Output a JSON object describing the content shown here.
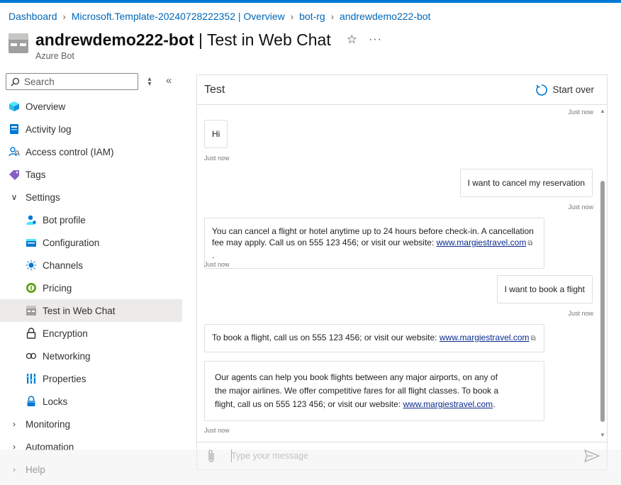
{
  "breadcrumb": {
    "items": [
      "Dashboard",
      "Microsoft.Template-20240728222352 | Overview",
      "bot-rg",
      "andrewdemo222-bot"
    ]
  },
  "header": {
    "resource_name": "andrewdemo222-bot",
    "page_name": "| Test in Web Chat",
    "subtitle": "Azure Bot",
    "favorite_icon": "star-icon",
    "more_icon": "ellipsis-icon"
  },
  "search": {
    "placeholder": "Search"
  },
  "nav": {
    "overview": "Overview",
    "activity_log": "Activity log",
    "access_control": "Access control (IAM)",
    "tags": "Tags",
    "settings": "Settings",
    "bot_profile": "Bot profile",
    "configuration": "Configuration",
    "channels": "Channels",
    "pricing": "Pricing",
    "test_web_chat": "Test in Web Chat",
    "encryption": "Encryption",
    "networking": "Networking",
    "properties": "Properties",
    "locks": "Locks",
    "monitoring": "Monitoring",
    "automation": "Automation",
    "help": "Help"
  },
  "chat": {
    "title": "Test",
    "start_over": "Start over",
    "timestamp": "Just now",
    "messages": {
      "m1": "Hi",
      "m2": "I want to cancel my reservation",
      "m3_line1": "You can cancel a flight or hotel anytime up to 24 hours before check-in. A cancellation",
      "m3_line2": "fee may apply. Call us on 555 123 456; or visit our website: ",
      "m4": "I want to book a flight",
      "m5": "To book a flight, call us on 555 123 456; or visit our website: ",
      "m6_line1": "Our agents can help you book flights between any major airports, on any of",
      "m6_line2": "the major airlines. We offer competitive fares for all flight classes. To book a",
      "m6_line3": "flight, call us on 555 123 456; or visit our website: "
    },
    "link": "www.margiestravel.com",
    "input_placeholder": "Type your message"
  },
  "colors": {
    "accent": "#0078d4",
    "link": "#0067b8",
    "active_bg": "#edebe9"
  }
}
